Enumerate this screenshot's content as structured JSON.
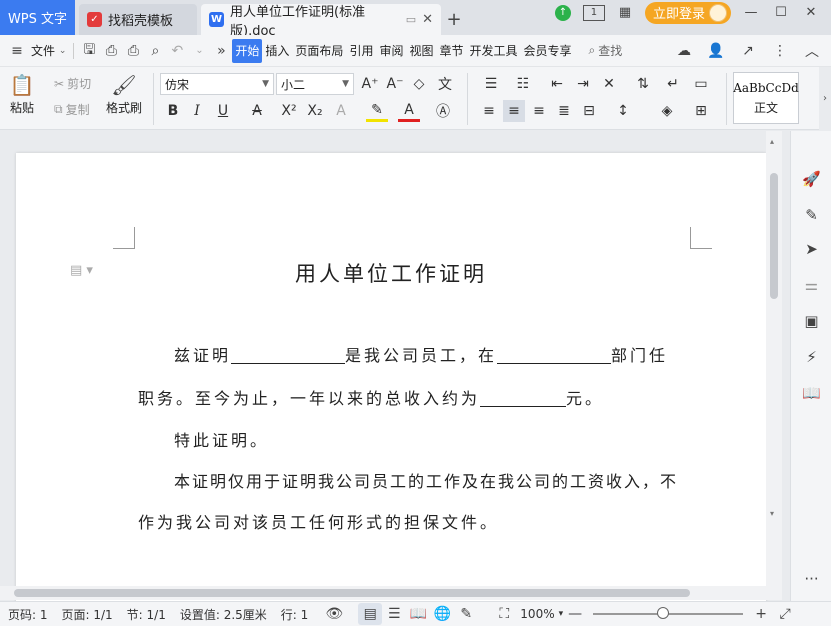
{
  "titlebar": {
    "app_tab": "WPS 文字",
    "tabs": [
      {
        "label": "找稻壳模板",
        "icon": "daoke-logo-icon"
      },
      {
        "label": "用人单位工作证明(标准版).doc",
        "icon": "wps-writer-icon"
      }
    ],
    "new_tab": "+",
    "layout_icon": "1",
    "login_label": "立即登录"
  },
  "menubar": {
    "file_label": "文件",
    "tabs": [
      "开始",
      "插入",
      "页面布局",
      "引用",
      "审阅",
      "视图",
      "章节",
      "开发工具",
      "会员专享"
    ],
    "active_tab": "开始",
    "search_label": "查找",
    "more": "»"
  },
  "ribbon": {
    "paste_label": "粘贴",
    "cut_label": "剪切",
    "copy_label": "复制",
    "format_painter_label": "格式刷",
    "font_name": "仿宋",
    "font_size": "小二",
    "style_sample": "AaBbCcDd",
    "style_name": "正文"
  },
  "document": {
    "title": "用人单位工作证明",
    "p1_a": "兹证明",
    "p1_b": "是我公司员工，在",
    "p1_c": "部门任",
    "p2_a": "职务。至今为止，一年以来的总收入约为",
    "p2_b": "元。",
    "p3": "特此证明。",
    "p4": "本证明仅用于证明我公司员工的工作及在我公司的工资收入，不",
    "p5": "作为我公司对该员工任何形式的担保文件。"
  },
  "statusbar": {
    "page_num": "页码: 1",
    "pages": "页面: 1/1",
    "section": "节: 1/1",
    "setting": "设置值: 2.5厘米",
    "row": "行: 1",
    "zoom": "100%"
  },
  "colors": {
    "accent": "#3b7bf0",
    "login": "#f5a623",
    "update": "#2cb24b"
  }
}
